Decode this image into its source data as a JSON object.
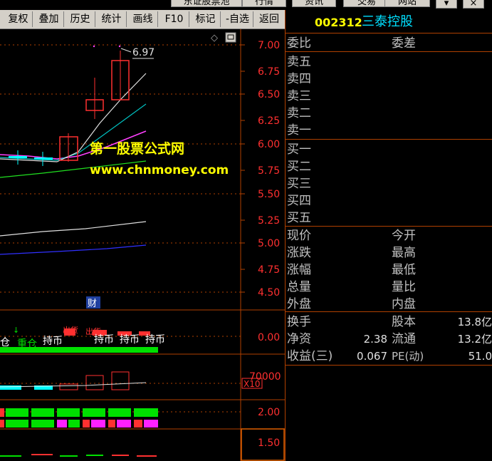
{
  "top_tabs": [
    {
      "label": "东证股票池"
    },
    {
      "label": "行情"
    },
    {
      "label": "资讯"
    },
    {
      "label": "交易"
    },
    {
      "label": "网站"
    }
  ],
  "toolbar": {
    "items": [
      "复权",
      "叠加",
      "历史",
      "统计",
      "画线",
      "F10",
      "标记",
      "-自选",
      "返回"
    ]
  },
  "price_axis": [
    "7.00",
    "6.75",
    "6.50",
    "6.25",
    "6.00",
    "5.75",
    "5.50",
    "5.25",
    "5.00",
    "4.75",
    "4.50"
  ],
  "price_tag": "6.97",
  "fin_badge": "财",
  "indicator1": {
    "axis": "0.00",
    "labels": [
      "仓",
      "重仓",
      "持币",
      "持币",
      "持币",
      "持币"
    ],
    "tops": [
      "↓",
      "出货",
      "出货"
    ]
  },
  "indicator2": {
    "axis": "70000",
    "unit": "X10"
  },
  "indicator3": {
    "axis": "2.00"
  },
  "indicator4": {
    "axis": "1.50"
  },
  "watermark": {
    "line1": "第一股票公式网",
    "line2": "www.chnmoney.com"
  },
  "quote": {
    "code": "002312",
    "name": "三泰控股",
    "header": {
      "left": "委比",
      "right": "委差"
    },
    "sell": [
      "卖五",
      "卖四",
      "卖三",
      "卖二",
      "卖一"
    ],
    "buy": [
      "买一",
      "买二",
      "买三",
      "买四",
      "买五"
    ],
    "stats_left": [
      "现价",
      "涨跌",
      "涨幅",
      "总量",
      "外盘"
    ],
    "stats_right": [
      "今开",
      "最高",
      "最低",
      "量比",
      "内盘"
    ],
    "fin": [
      {
        "label": "换手",
        "value": "",
        "label2": "股本",
        "value2": "13.8亿"
      },
      {
        "label": "净资",
        "value": "2.38",
        "label2": "流通",
        "value2": "13.2亿"
      },
      {
        "label": "收益(三)",
        "value": "0.067",
        "label2": "PE(动)",
        "value2": "51.0"
      }
    ]
  },
  "colors": {
    "up": "#ff3030",
    "down": "#00ffff",
    "axis": "#b04000",
    "accent": "#00e0ff",
    "code": "#ffff00"
  }
}
